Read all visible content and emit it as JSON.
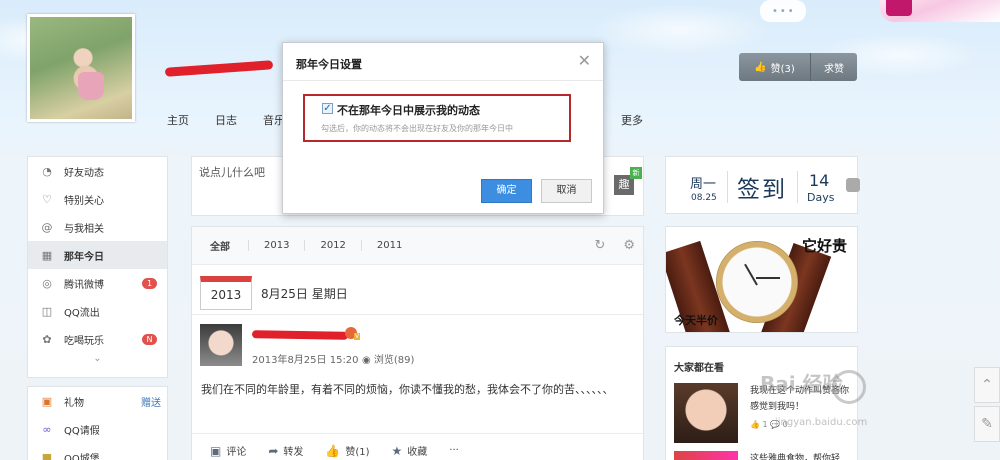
{
  "header": {
    "nav": [
      "主页",
      "日志",
      "音乐"
    ],
    "nav_more": "更多",
    "praise_label": "赞(3)",
    "ask_label": "求赞"
  },
  "sidebar": {
    "items": [
      {
        "label": "好友动态",
        "icon": "friends-icon"
      },
      {
        "label": "特别关心",
        "icon": "heart-icon"
      },
      {
        "label": "与我相关",
        "icon": "at-icon"
      },
      {
        "label": "那年今日",
        "icon": "calendar-icon"
      },
      {
        "label": "腾讯微博",
        "icon": "weibo-icon",
        "badge": "1"
      },
      {
        "label": "QQ流出",
        "icon": "qq-icon"
      },
      {
        "label": "吃喝玩乐",
        "icon": "gamepad-icon",
        "badge": "N"
      }
    ],
    "items2": [
      {
        "label": "礼物",
        "icon": "gift-icon",
        "extra": "赠送"
      },
      {
        "label": "QQ请假",
        "icon": "glasses-icon"
      },
      {
        "label": "QQ城堡",
        "icon": "castle-icon"
      }
    ]
  },
  "post_box": {
    "placeholder": "说点儿什么吧",
    "qu_label": "趣",
    "new_label": "新"
  },
  "feed": {
    "tabs": [
      "全部",
      "2013",
      "2012",
      "2011"
    ],
    "calendar_year": "2013",
    "date_text": "8月25日 星期日",
    "status": {
      "time": "2013年8月25日 15:20",
      "views": "浏览(89)",
      "body": "我们在不同的年龄里，有着不同的烦恼，你读不懂我的愁，我体会不了你的苦、、、、、、"
    },
    "actions": [
      {
        "label": "评论",
        "icon": "comment-icon"
      },
      {
        "label": "转发",
        "icon": "share-icon"
      },
      {
        "label": "赞(1)",
        "icon": "like-icon"
      },
      {
        "label": "收藏",
        "icon": "star-icon"
      },
      {
        "label": "···",
        "icon": "more-icon"
      }
    ]
  },
  "sign": {
    "weekday": "周一",
    "date": "08.25",
    "title": "签到",
    "count": "14",
    "unit": "Days"
  },
  "ad": {
    "title": "它好贵",
    "sub": "今天半价"
  },
  "hot": {
    "title": "大家都在看",
    "item1": "我现在这个动作叫赞吝你感觉到我吗！",
    "item1_meta": "👍 1 💬 0",
    "item2": "这些雅典食物，帮你轻"
  },
  "watermark": {
    "text": "Bai 经验",
    "sub": "jingyan.baidu.com"
  },
  "dialog": {
    "title": "那年今日设置",
    "option_label": "不在那年今日中展示我的动态",
    "hint": "勾选后，你的动态将不会出现在好友及你的那年今日中",
    "ok": "确定",
    "cancel": "取消"
  }
}
